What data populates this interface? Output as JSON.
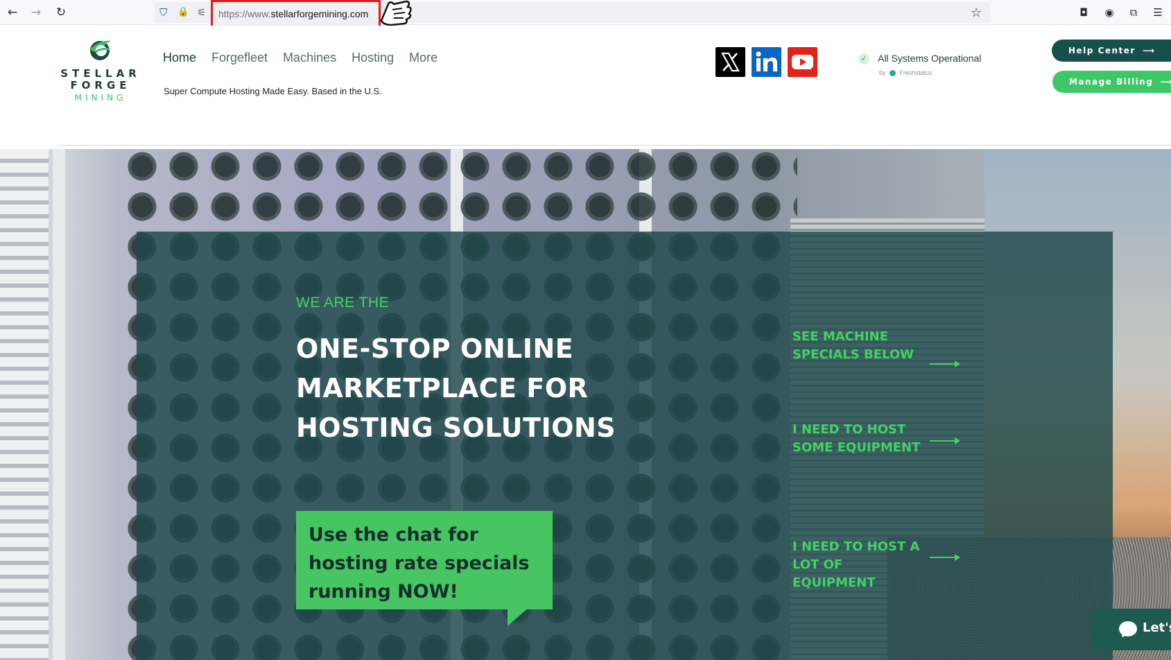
{
  "browser": {
    "url_prefix": "https://www.",
    "url_domain": "stellarforgemining.com",
    "icons": {
      "back": "←",
      "forward": "→",
      "reload": "↻",
      "shield": "⛉",
      "lock": "🔒",
      "permissions": "⚟",
      "bookmark": "☆",
      "pocket": "◘",
      "account": "◉",
      "extensions": "⧉",
      "menu": "☰"
    }
  },
  "site": {
    "logo": {
      "line1": "STELLAR",
      "line2": "FORGE",
      "line3": "MINING"
    },
    "nav": {
      "home": "Home",
      "forgefleet": "Forgefleet",
      "machines": "Machines",
      "hosting": "Hosting",
      "more": "More"
    },
    "tagline": "Super Compute Hosting Made Easy. Based in the U.S.",
    "status": {
      "check": "✓",
      "text": "All Systems Operational",
      "by": "by",
      "provider": "Freshstatus"
    },
    "buttons": {
      "help_center": "Help Center",
      "manage_billing": "Manage Billing",
      "arrow": "⟶"
    }
  },
  "hero": {
    "eyebrow": "WE ARE THE",
    "headline_1": "ONE-STOP ONLINE",
    "headline_2": "MARKETPLACE FOR",
    "headline_3": "HOSTING SOLUTIONS",
    "bubble_1": "Use the chat for",
    "bubble_2": "hosting rate specials",
    "bubble_3": "running NOW!",
    "cta_1_a": "SEE MACHINE",
    "cta_1_b": "SPECIALS BELOW",
    "cta_2_a": "I NEED TO HOST",
    "cta_2_b": "SOME EQUIPMENT",
    "cta_3_a": "I NEED TO HOST A",
    "cta_3_b": "LOT OF",
    "cta_3_c": "EQUIPMENT",
    "chat_label": "Let's"
  },
  "colors": {
    "accent_green": "#42d263",
    "dark_teal": "#17504a",
    "billing_green": "#3cc866",
    "highlight_red": "#e21b1b"
  }
}
